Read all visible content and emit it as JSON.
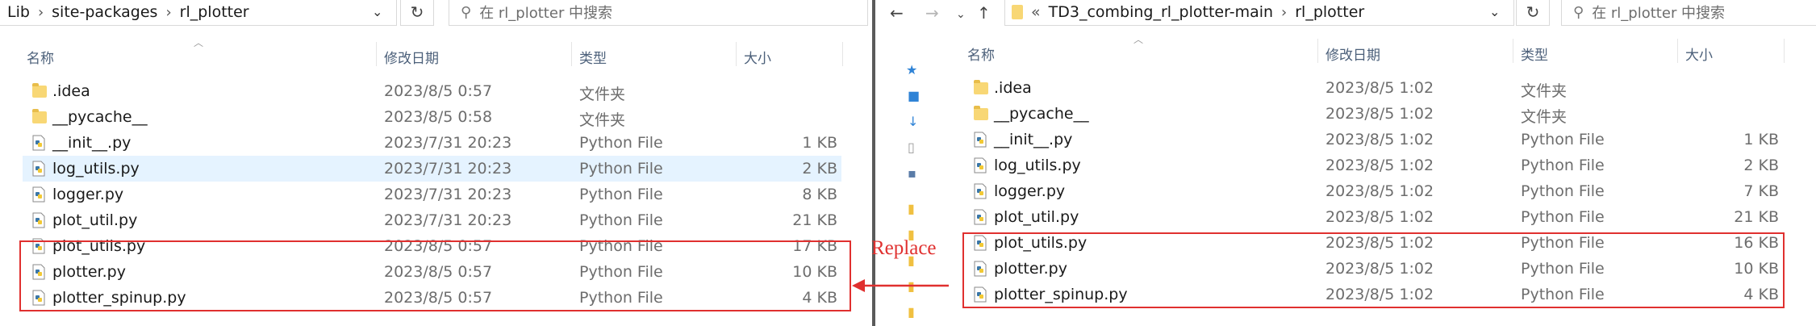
{
  "left": {
    "breadcrumb": [
      "Lib",
      "site-packages",
      "rl_plotter"
    ],
    "search_placeholder": "在 rl_plotter 中搜索",
    "columns": {
      "name": "名称",
      "date": "修改日期",
      "type": "类型",
      "size": "大小"
    },
    "files": [
      {
        "name": ".idea",
        "date": "2023/8/5 0:57",
        "type": "文件夹",
        "size": "",
        "icon": "folder-icon"
      },
      {
        "name": "__pycache__",
        "date": "2023/8/5 0:58",
        "type": "文件夹",
        "size": "",
        "icon": "folder-icon"
      },
      {
        "name": "__init__.py",
        "date": "2023/7/31 20:23",
        "type": "Python File",
        "size": "1 KB",
        "icon": "python-file-icon"
      },
      {
        "name": "log_utils.py",
        "date": "2023/7/31 20:23",
        "type": "Python File",
        "size": "2 KB",
        "icon": "python-file-icon",
        "selected": true
      },
      {
        "name": "logger.py",
        "date": "2023/7/31 20:23",
        "type": "Python File",
        "size": "8 KB",
        "icon": "python-file-icon"
      },
      {
        "name": "plot_util.py",
        "date": "2023/7/31 20:23",
        "type": "Python File",
        "size": "21 KB",
        "icon": "python-file-icon"
      },
      {
        "name": "plot_utils.py",
        "date": "2023/8/5 0:57",
        "type": "Python File",
        "size": "17 KB",
        "icon": "python-file-icon"
      },
      {
        "name": "plotter.py",
        "date": "2023/8/5 0:57",
        "type": "Python File",
        "size": "10 KB",
        "icon": "python-file-icon"
      },
      {
        "name": "plotter_spinup.py",
        "date": "2023/8/5 0:57",
        "type": "Python File",
        "size": "4 KB",
        "icon": "python-file-icon"
      }
    ]
  },
  "right": {
    "breadcrumb_prefix": "«",
    "breadcrumb": [
      "TD3_combing_rl_plotter-main",
      "rl_plotter"
    ],
    "search_placeholder": "在 rl_plotter 中搜索",
    "columns": {
      "name": "名称",
      "date": "修改日期",
      "type": "类型",
      "size": "大小"
    },
    "files": [
      {
        "name": ".idea",
        "date": "2023/8/5 1:02",
        "type": "文件夹",
        "size": "",
        "icon": "folder-icon"
      },
      {
        "name": "__pycache__",
        "date": "2023/8/5 1:02",
        "type": "文件夹",
        "size": "",
        "icon": "folder-icon"
      },
      {
        "name": "__init__.py",
        "date": "2023/8/5 1:02",
        "type": "Python File",
        "size": "1 KB",
        "icon": "python-file-icon"
      },
      {
        "name": "log_utils.py",
        "date": "2023/8/5 1:02",
        "type": "Python File",
        "size": "2 KB",
        "icon": "python-file-icon"
      },
      {
        "name": "logger.py",
        "date": "2023/8/5 1:02",
        "type": "Python File",
        "size": "7 KB",
        "icon": "python-file-icon"
      },
      {
        "name": "plot_util.py",
        "date": "2023/8/5 1:02",
        "type": "Python File",
        "size": "21 KB",
        "icon": "python-file-icon"
      },
      {
        "name": "plot_utils.py",
        "date": "2023/8/5 1:02",
        "type": "Python File",
        "size": "16 KB",
        "icon": "python-file-icon"
      },
      {
        "name": "plotter.py",
        "date": "2023/8/5 1:02",
        "type": "Python File",
        "size": "10 KB",
        "icon": "python-file-icon"
      },
      {
        "name": "plotter_spinup.py",
        "date": "2023/8/5 1:02",
        "type": "Python File",
        "size": "4 KB",
        "icon": "python-file-icon"
      }
    ]
  },
  "annotation": {
    "label": "Replace",
    "color": "#e0302f"
  }
}
